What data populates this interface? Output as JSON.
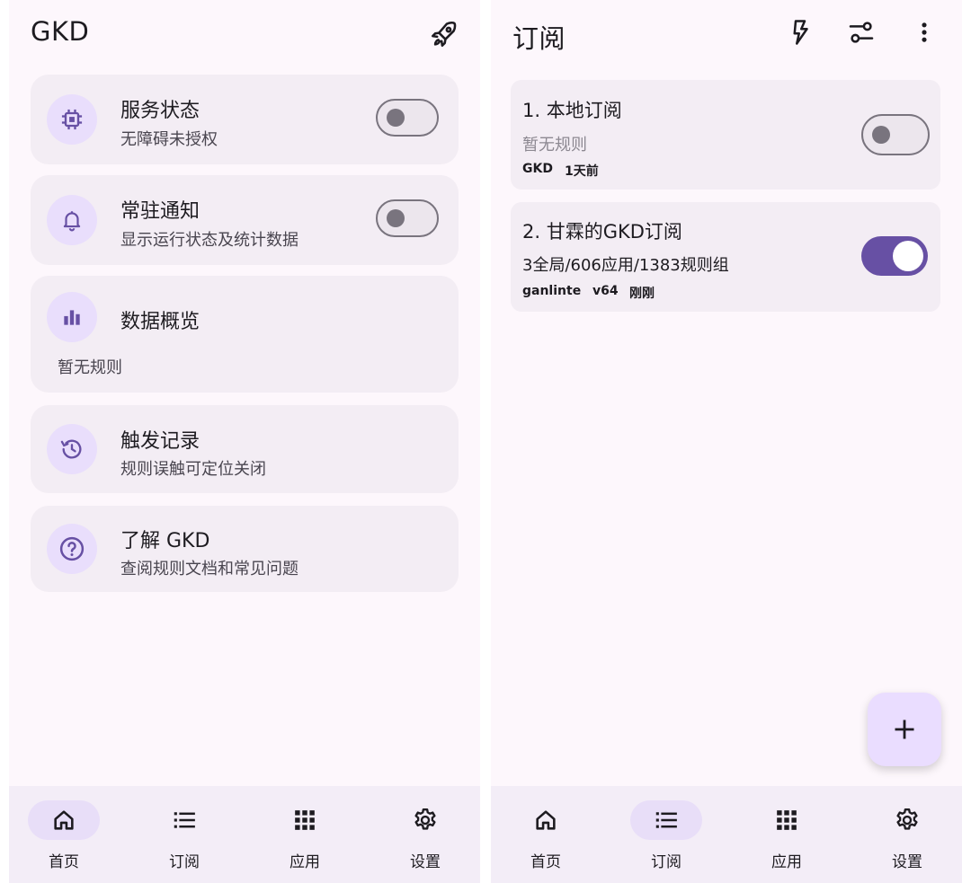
{
  "home": {
    "title": "GKD",
    "cards": [
      {
        "title": "服务状态",
        "subtitle": "无障碍未授权",
        "icon": "chip-icon",
        "switch_on": false
      },
      {
        "title": "常驻通知",
        "subtitle": "显示运行状态及统计数据",
        "icon": "bell-icon",
        "switch_on": false
      },
      {
        "title": "数据概览",
        "subtitle": "暂无规则",
        "icon": "bar-chart-icon"
      },
      {
        "title": "触发记录",
        "subtitle": "规则误触可定位关闭",
        "icon": "history-icon"
      },
      {
        "title": "了解 GKD",
        "subtitle": "查阅规则文档和常见问题",
        "icon": "help-circle-icon"
      }
    ],
    "top_icon": "rocket-icon"
  },
  "subscriptions": {
    "title": "订阅",
    "top_icons": [
      "flash-icon",
      "tune-icon",
      "more-vert-icon"
    ],
    "items": [
      {
        "title": "1. 本地订阅",
        "description": "暂无规则",
        "meta": [
          "GKD",
          "1天前"
        ],
        "switch_on": false
      },
      {
        "title": "2. 甘霖的GKD订阅",
        "description": "3全局/606应用/1383规则组",
        "meta": [
          "ganlinte",
          "v64",
          "刚刚"
        ],
        "switch_on": true
      }
    ],
    "fab_icon": "add-icon"
  },
  "nav": {
    "items": [
      {
        "label": "首页",
        "icon": "home-icon"
      },
      {
        "label": "订阅",
        "icon": "list-icon"
      },
      {
        "label": "应用",
        "icon": "apps-grid-icon"
      },
      {
        "label": "设置",
        "icon": "settings-icon"
      }
    ]
  },
  "colors": {
    "accent": "#6750a4",
    "icon_circle": "#e9defc",
    "card": "#f3edf4",
    "background": "#fdf7fc"
  }
}
